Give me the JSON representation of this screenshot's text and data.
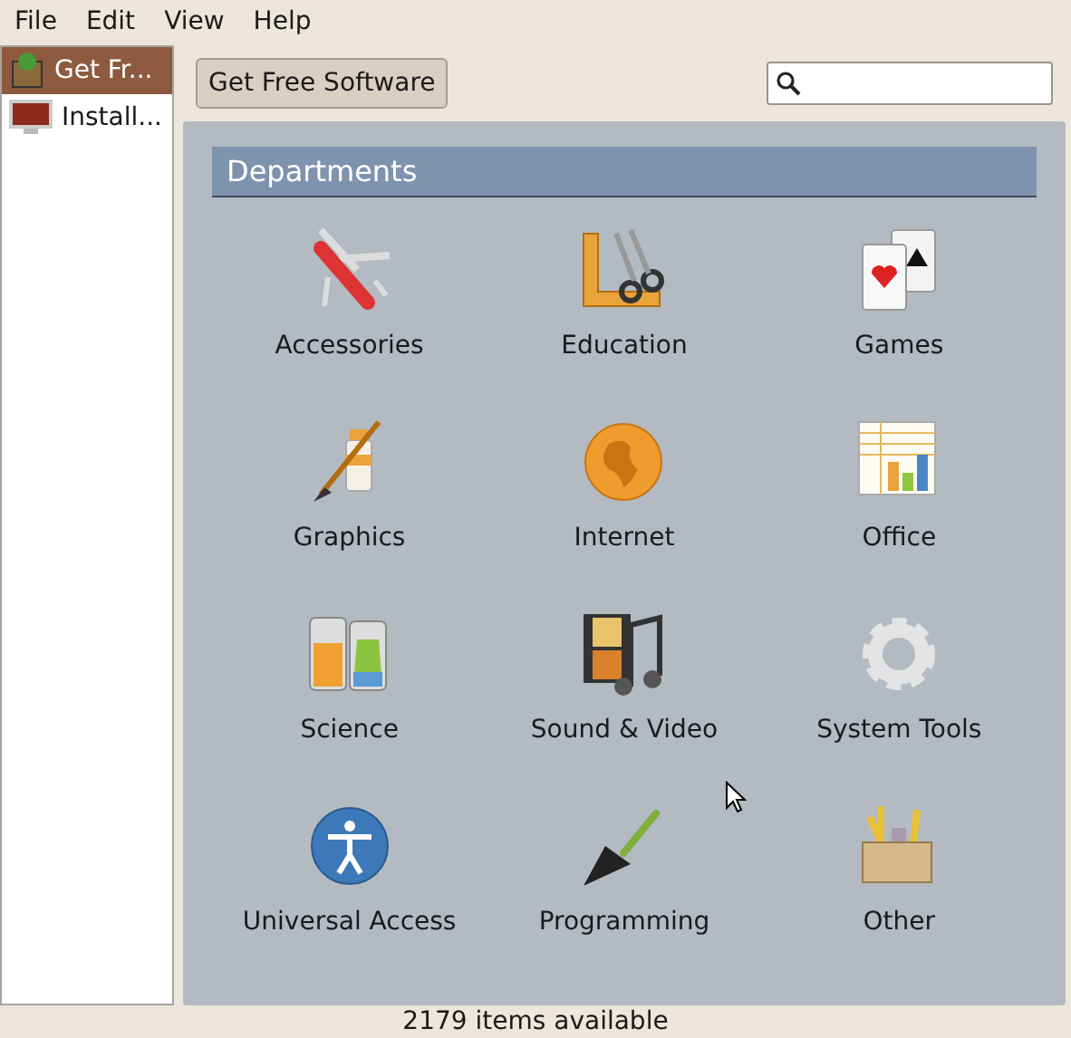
{
  "menu": [
    "File",
    "Edit",
    "View",
    "Help"
  ],
  "sidebar": {
    "items": [
      {
        "label": "Get Fr...",
        "kind": "store",
        "selected": true
      },
      {
        "label": "Install...",
        "kind": "monitor",
        "selected": false
      }
    ]
  },
  "toolbar": {
    "button": "Get Free Software"
  },
  "departments": {
    "title": "Departments",
    "items": [
      {
        "label": "Accessories",
        "kind": "knife"
      },
      {
        "label": "Education",
        "kind": "ruler"
      },
      {
        "label": "Games",
        "kind": "cards"
      },
      {
        "label": "Graphics",
        "kind": "paint"
      },
      {
        "label": "Internet",
        "kind": "globe"
      },
      {
        "label": "Office",
        "kind": "spreadsheet"
      },
      {
        "label": "Science",
        "kind": "beakers"
      },
      {
        "label": "Sound & Video",
        "kind": "media"
      },
      {
        "label": "System Tools",
        "kind": "gear"
      },
      {
        "label": "Universal Access",
        "kind": "access"
      },
      {
        "label": "Programming",
        "kind": "trowel"
      },
      {
        "label": "Other",
        "kind": "box"
      }
    ]
  },
  "status_bar": "2179 items available"
}
